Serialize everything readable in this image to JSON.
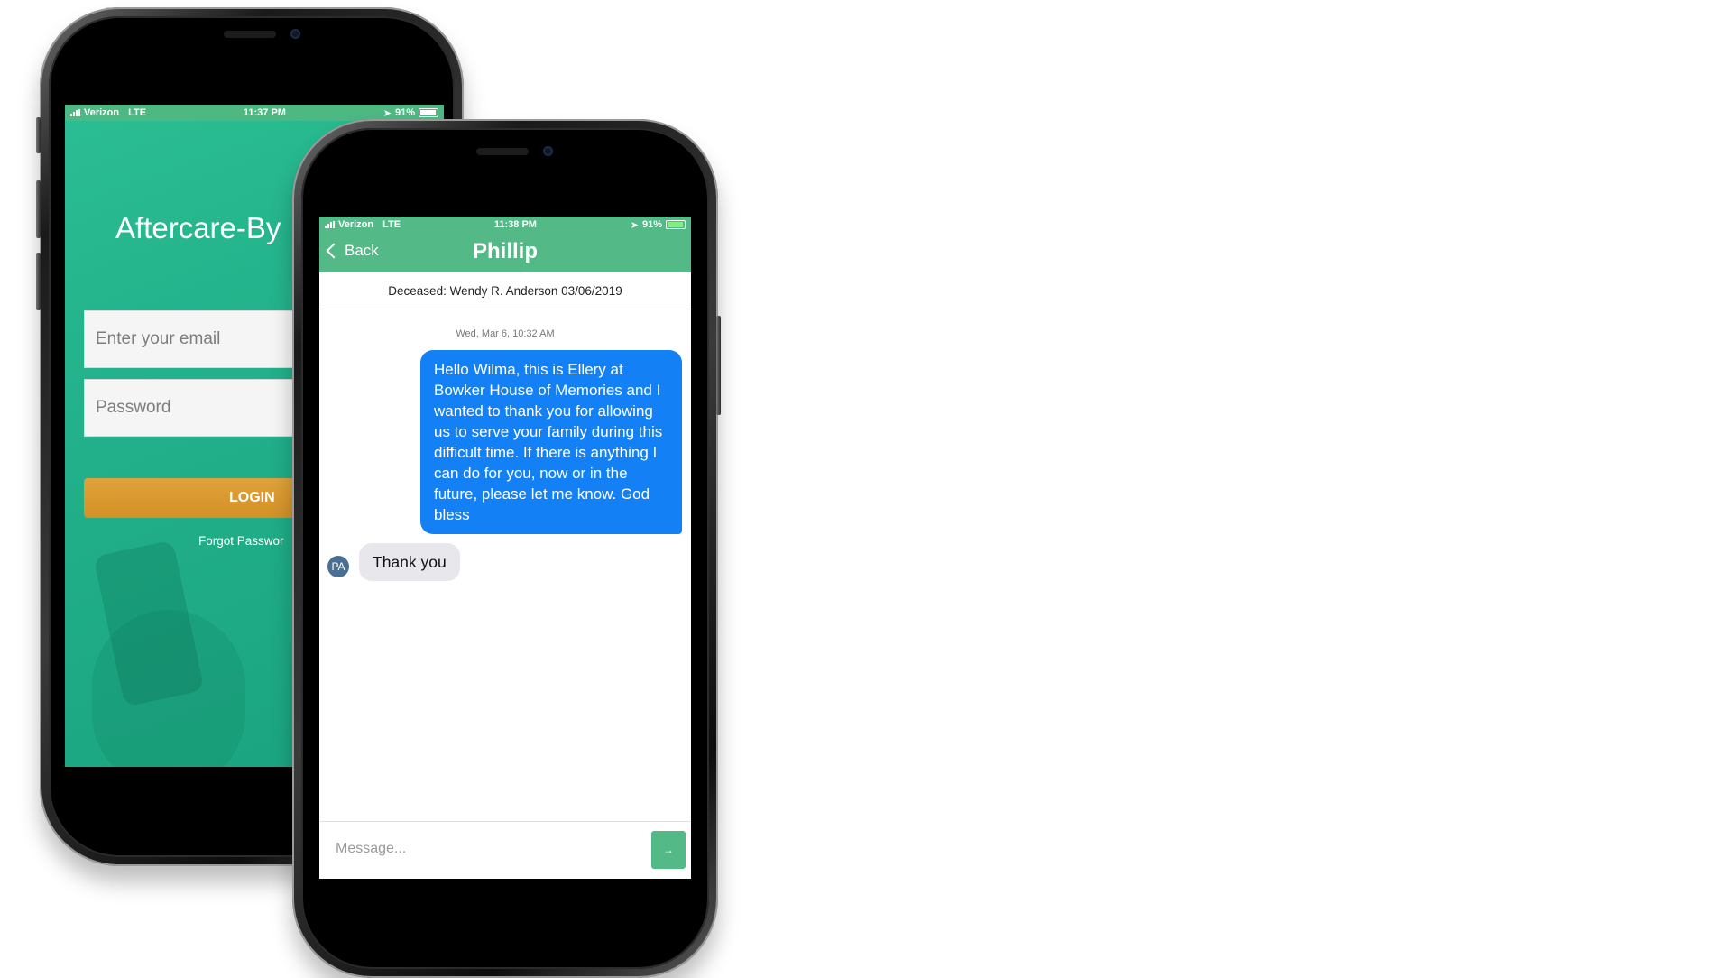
{
  "back_phone": {
    "status_bar": {
      "carrier": "Verizon",
      "network": "LTE",
      "time": "11:37 PM",
      "battery": "91%"
    },
    "app_title": "Aftercare-By",
    "email_placeholder": "Enter your email",
    "password_placeholder": "Password",
    "login_label": "LOGIN",
    "forgot_label": "Forgot Passwor",
    "colors": {
      "background": "#21b08a",
      "status_bar": "#4db882",
      "login_button": "#d9992e"
    }
  },
  "front_phone": {
    "status_bar": {
      "carrier": "Verizon",
      "network": "LTE",
      "time": "11:38 PM",
      "battery": "91%"
    },
    "nav": {
      "back_label": "Back",
      "title": "Phillip"
    },
    "deceased_banner": "Deceased: Wendy R. Anderson 03/06/2019",
    "timestamp": "Wed, Mar 6, 10:32 AM",
    "messages": [
      {
        "direction": "outgoing",
        "text": "Hello Wilma, this is Ellery at Bowker House of Memories and I wanted to thank you for allowing us to serve your family during this difficult time. If there is anything I can do for you, now or in the future, please let me know. God bless"
      },
      {
        "direction": "incoming",
        "avatar_initials": "PA",
        "text": "Thank you"
      }
    ],
    "composer": {
      "placeholder": "Message...",
      "send_icon": "→"
    },
    "colors": {
      "nav": "#52b987",
      "outgoing_bubble": "#1480f5",
      "incoming_bubble": "#e8e8ec",
      "avatar": "#4b6f93"
    }
  }
}
